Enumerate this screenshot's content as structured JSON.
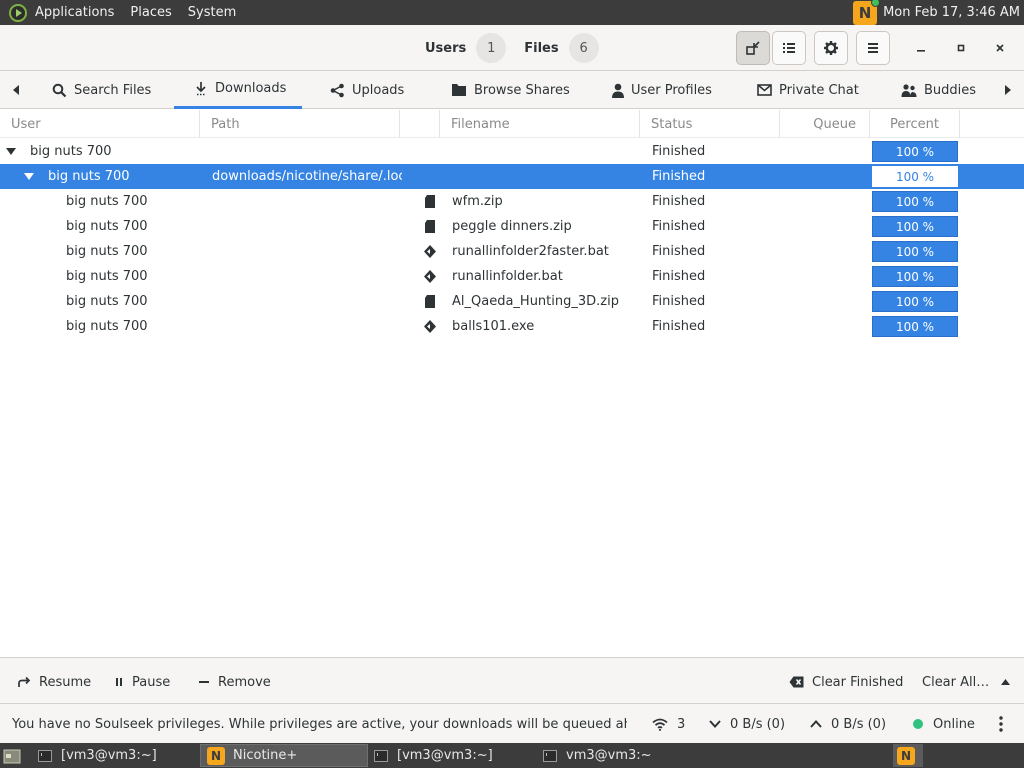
{
  "top_panel": {
    "menus": [
      "Applications",
      "Places",
      "System"
    ],
    "clock": "Mon Feb 17,  3:46 AM"
  },
  "header": {
    "users_label": "Users",
    "users_count": "1",
    "files_label": "Files",
    "files_count": "6"
  },
  "tabs": [
    {
      "label": "Search Files",
      "icon": "search-icon"
    },
    {
      "label": "Downloads",
      "icon": "download-icon",
      "active": true
    },
    {
      "label": "Uploads",
      "icon": "share-icon"
    },
    {
      "label": "Browse Shares",
      "icon": "folder-icon"
    },
    {
      "label": "User Profiles",
      "icon": "user-icon"
    },
    {
      "label": "Private Chat",
      "icon": "mail-icon"
    },
    {
      "label": "Buddies",
      "icon": "buddies-icon"
    }
  ],
  "columns": {
    "user": "User",
    "path": "Path",
    "filename": "Filename",
    "status": "Status",
    "queue": "Queue",
    "percent": "Percent"
  },
  "rows": [
    {
      "user": "big nuts 700",
      "path": "",
      "filename": "",
      "status": "Finished",
      "percent": "100 %"
    },
    {
      "user": "big nuts 700",
      "path": "downloads/nicotine/share/.loca",
      "filename": "",
      "status": "Finished",
      "percent": "100 %"
    },
    {
      "user": "big nuts 700",
      "path": "",
      "filename": "wfm.zip",
      "status": "Finished",
      "percent": "100 %",
      "file_icon": "archive-icon"
    },
    {
      "user": "big nuts 700",
      "path": "",
      "filename": "peggle dinners.zip",
      "status": "Finished",
      "percent": "100 %",
      "file_icon": "archive-icon"
    },
    {
      "user": "big nuts 700",
      "path": "",
      "filename": "runallinfolder2faster.bat",
      "status": "Finished",
      "percent": "100 %",
      "file_icon": "executable-icon"
    },
    {
      "user": "big nuts 700",
      "path": "",
      "filename": "runallinfolder.bat",
      "status": "Finished",
      "percent": "100 %",
      "file_icon": "executable-icon"
    },
    {
      "user": "big nuts 700",
      "path": "",
      "filename": "Al_Qaeda_Hunting_3D.zip",
      "status": "Finished",
      "percent": "100 %",
      "file_icon": "archive-icon"
    },
    {
      "user": "big nuts 700",
      "path": "",
      "filename": "balls101.exe",
      "status": "Finished",
      "percent": "100 %",
      "file_icon": "executable-icon"
    }
  ],
  "actions": {
    "resume": "Resume",
    "pause": "Pause",
    "remove": "Remove",
    "clear_finished": "Clear Finished",
    "clear_all": "Clear All…"
  },
  "status_bar": {
    "message": "You have no Soulseek privileges. While privileges are active, your downloads will be queued ahead of …",
    "connections": "3",
    "download_speed": "0 B/s (0)",
    "upload_speed": "0 B/s (0)",
    "status": "Online"
  },
  "taskbar": {
    "tasks": [
      "[vm3@vm3:~]",
      "Nicotine+",
      "[vm3@vm3:~]",
      "vm3@vm3:~"
    ]
  },
  "colors": {
    "accent": "#3584e4",
    "online": "#2ec27e",
    "panel": "#3c3c3c",
    "nicotine_logo": "#f6a61d"
  }
}
